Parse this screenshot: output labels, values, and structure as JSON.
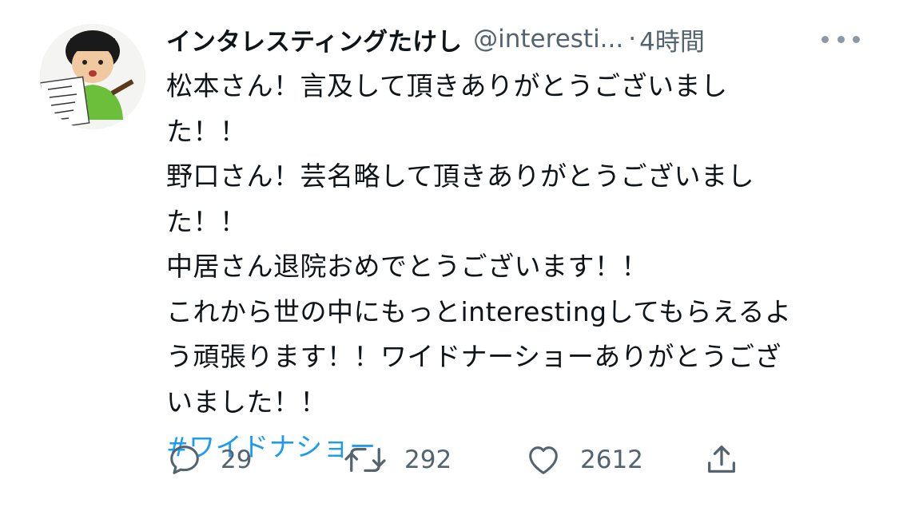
{
  "tweet": {
    "author_name": "インタレスティングたけし",
    "author_handle": "@interesti...",
    "separator": "·",
    "time": "4時間",
    "avatar_sign_text": [
      "インタレ",
      "スティング",
      "ホームレ",
      "ス・ワイ",
      "ドナー"
    ],
    "body_lines": [
      "松本さん！言及して頂きありがとうございまし",
      "た！！",
      "野口さん！芸名略して頂きありがとうございまし",
      "た！！",
      "中居さん退院おめでとうございます！！",
      "これから世の中にもっとinterestingしてもらえるよ",
      "う頑張ります！！ワイドナーショーありがとうござ",
      "いました！！"
    ],
    "hashtag": "#ワイドナショー",
    "hashtag_color": "#1d9bf0"
  },
  "actions": {
    "reply": {
      "icon": "reply-icon",
      "count": "29"
    },
    "retweet": {
      "icon": "retweet-icon",
      "count": "292"
    },
    "like": {
      "icon": "heart-icon",
      "count": "2612"
    },
    "share": {
      "icon": "share-icon"
    }
  },
  "colors": {
    "text": "#0f1419",
    "secondary": "#536471",
    "link": "#1d9bf0",
    "icon": "#536471"
  }
}
